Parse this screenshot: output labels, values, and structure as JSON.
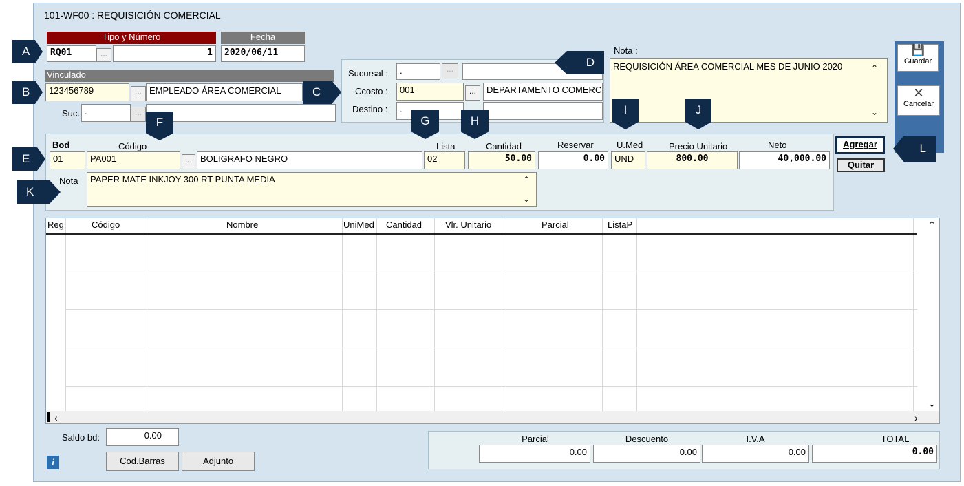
{
  "window": {
    "title": "101-WF00 : REQUISICIÓN COMERCIAL"
  },
  "callouts": [
    "A",
    "B",
    "C",
    "D",
    "E",
    "F",
    "G",
    "H",
    "I",
    "J",
    "K",
    "L"
  ],
  "header": {
    "tipo_label": "Tipo y Número",
    "tipo_value": "RQ01",
    "numero_value": "1",
    "fecha_label": "Fecha",
    "fecha_value": "2020/06/11",
    "dots": "..."
  },
  "vinculado": {
    "label": "Vinculado",
    "id_value": "123456789",
    "name_value": "EMPLEADO ÁREA COMERCIAL",
    "suc_label": "Suc.",
    "suc_value": "."
  },
  "sucursal": {
    "sucursal_label": "Sucursal :",
    "sucursal_value": ".",
    "ccosto_label": "Ccosto :",
    "ccosto_value": "001",
    "ccosto_name": "DEPARTAMENTO COMERC",
    "destino_label": "Destino :",
    "destino_value": "."
  },
  "nota_header": {
    "label": "Nota :",
    "value": "REQUISICIÓN ÁREA COMERCIAL MES DE JUNIO 2020"
  },
  "toolbar": {
    "guardar": "Guardar",
    "cancelar": "Cancelar"
  },
  "item": {
    "bod_label": "Bod",
    "codigo_label": "Código",
    "lista_label": "Lista",
    "cantidad_label": "Cantidad",
    "reservar_label": "Reservar",
    "umed_label": "U.Med",
    "precio_label": "Precio Unitario",
    "neto_label": "Neto",
    "bod_value": "01",
    "codigo_value": "PA001",
    "desc_value": "BOLIGRAFO NEGRO",
    "lista_value": "02",
    "cantidad_value": "50.00",
    "reservar_value": "0.00",
    "umed_value": "UND",
    "precio_value": "800.00",
    "neto_value": "40,000.00",
    "nota_label": "Nota",
    "nota_value": "PAPER MATE INKJOY 300 RT PUNTA MEDIA",
    "agregar": "Agregar",
    "quitar": "Quitar"
  },
  "grid": {
    "columns": [
      "Reg",
      "Código",
      "Nombre",
      "UniMed",
      "Cantidad",
      "Vlr. Unitario",
      "Parcial",
      "ListaP"
    ],
    "rows": []
  },
  "footer": {
    "saldo_label": "Saldo bd:",
    "saldo_value": "0.00",
    "cod_barras": "Cod.Barras",
    "adjunto": "Adjunto",
    "info_icon": "i",
    "parcial_label": "Parcial",
    "descuento_label": "Descuento",
    "iva_label": "I.V.A",
    "total_label": "TOTAL",
    "parcial_value": "0.00",
    "descuento_value": "0.00",
    "iva_value": "0.00",
    "total_value": "0.00"
  },
  "colors": {
    "callout": "#102a4a",
    "header_red": "#8b0000",
    "field_yellow": "#fffde3",
    "window_bg": "#d6e4f0"
  }
}
